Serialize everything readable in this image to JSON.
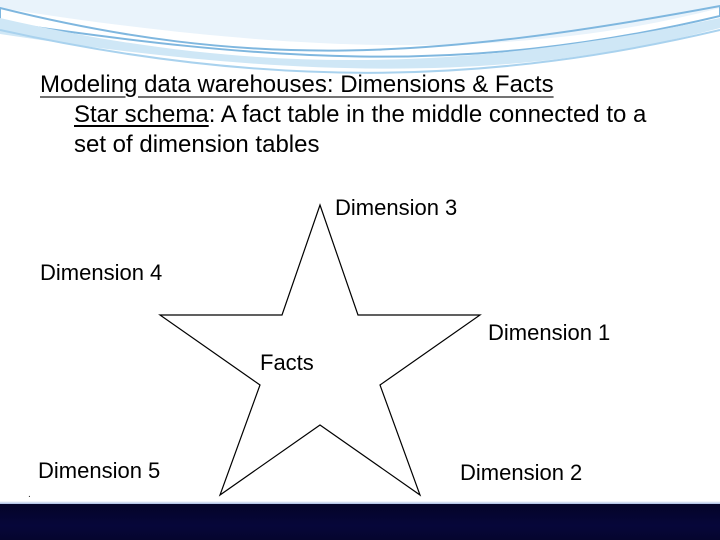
{
  "title": {
    "line1": "Modeling data warehouses: Dimensions & Facts",
    "schema_label": "Star schema",
    "line2_rest": ": A fact table in the middle connected to a set of dimension tables"
  },
  "labels": {
    "dim1": "Dimension 1",
    "dim2": "Dimension 2",
    "dim3": "Dimension 3",
    "dim4": "Dimension 4",
    "dim5": "Dimension 5",
    "facts": "Facts"
  },
  "misc": {
    "dot": "."
  }
}
